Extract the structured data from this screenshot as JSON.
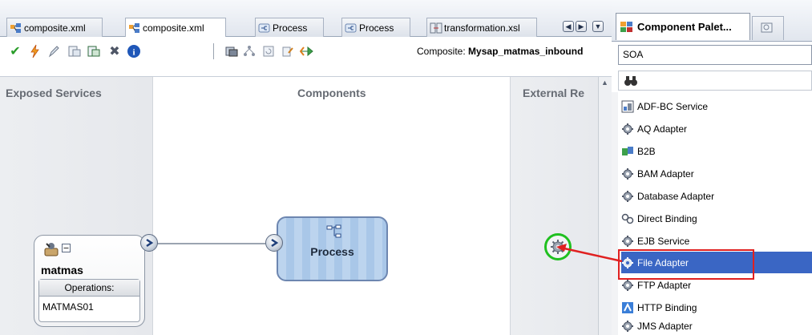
{
  "editor": {
    "tabs": [
      {
        "label": "composite.xml",
        "icon": "composite-icon",
        "active": false
      },
      {
        "label": "composite.xml",
        "icon": "composite-icon",
        "active": true
      },
      {
        "label": "Process",
        "icon": "process-icon",
        "active": false
      },
      {
        "label": "Process",
        "icon": "process-icon",
        "active": false
      },
      {
        "label": "transformation.xsl",
        "icon": "xsl-icon",
        "active": false
      }
    ],
    "nav_buttons": [
      "◀",
      "▶",
      "▼"
    ],
    "toolbar": {
      "icons": [
        "checkmark-icon",
        "lightning-icon",
        "pencil-icon",
        "import-icon",
        "export-icon",
        "delete-icon",
        "info-icon",
        "deploy-icon",
        "layout-icon",
        "refresh-icon",
        "configure-icon",
        "navigate-icon"
      ],
      "composite_label": "Composite:",
      "composite_name": "Mysap_matmas_inbound"
    },
    "swimlanes": {
      "left": "Exposed Services",
      "middle": "Components",
      "right": "External Re"
    },
    "service": {
      "name": "matmas",
      "operations_label": "Operations:",
      "operation": "MATMAS01"
    },
    "process": {
      "name": "Process"
    }
  },
  "palette": {
    "tab_title": "Component Palet...",
    "select_value": "SOA",
    "items": [
      {
        "label": "ADF-BC Service",
        "icon": "adf-bc-icon",
        "selected": false
      },
      {
        "label": "AQ Adapter",
        "icon": "adapter-gear-icon",
        "selected": false
      },
      {
        "label": "B2B",
        "icon": "b2b-icon",
        "selected": false
      },
      {
        "label": "BAM Adapter",
        "icon": "adapter-gear-icon",
        "selected": false
      },
      {
        "label": "Database Adapter",
        "icon": "adapter-gear-icon",
        "selected": false
      },
      {
        "label": "Direct Binding",
        "icon": "binding-icon",
        "selected": false
      },
      {
        "label": "EJB Service",
        "icon": "adapter-gear-icon",
        "selected": false
      },
      {
        "label": "File Adapter",
        "icon": "adapter-gear-icon",
        "selected": true
      },
      {
        "label": "FTP Adapter",
        "icon": "adapter-gear-icon",
        "selected": false
      },
      {
        "label": "HTTP Binding",
        "icon": "http-icon",
        "selected": false
      },
      {
        "label": "JMS Adapter",
        "icon": "adapter-gear-icon",
        "selected": false
      }
    ]
  },
  "colors": {
    "selection": "#3a66c4",
    "annotation_red": "#e02020",
    "drop_target_green": "#20c020",
    "process_blue": "#a9c7e8"
  }
}
